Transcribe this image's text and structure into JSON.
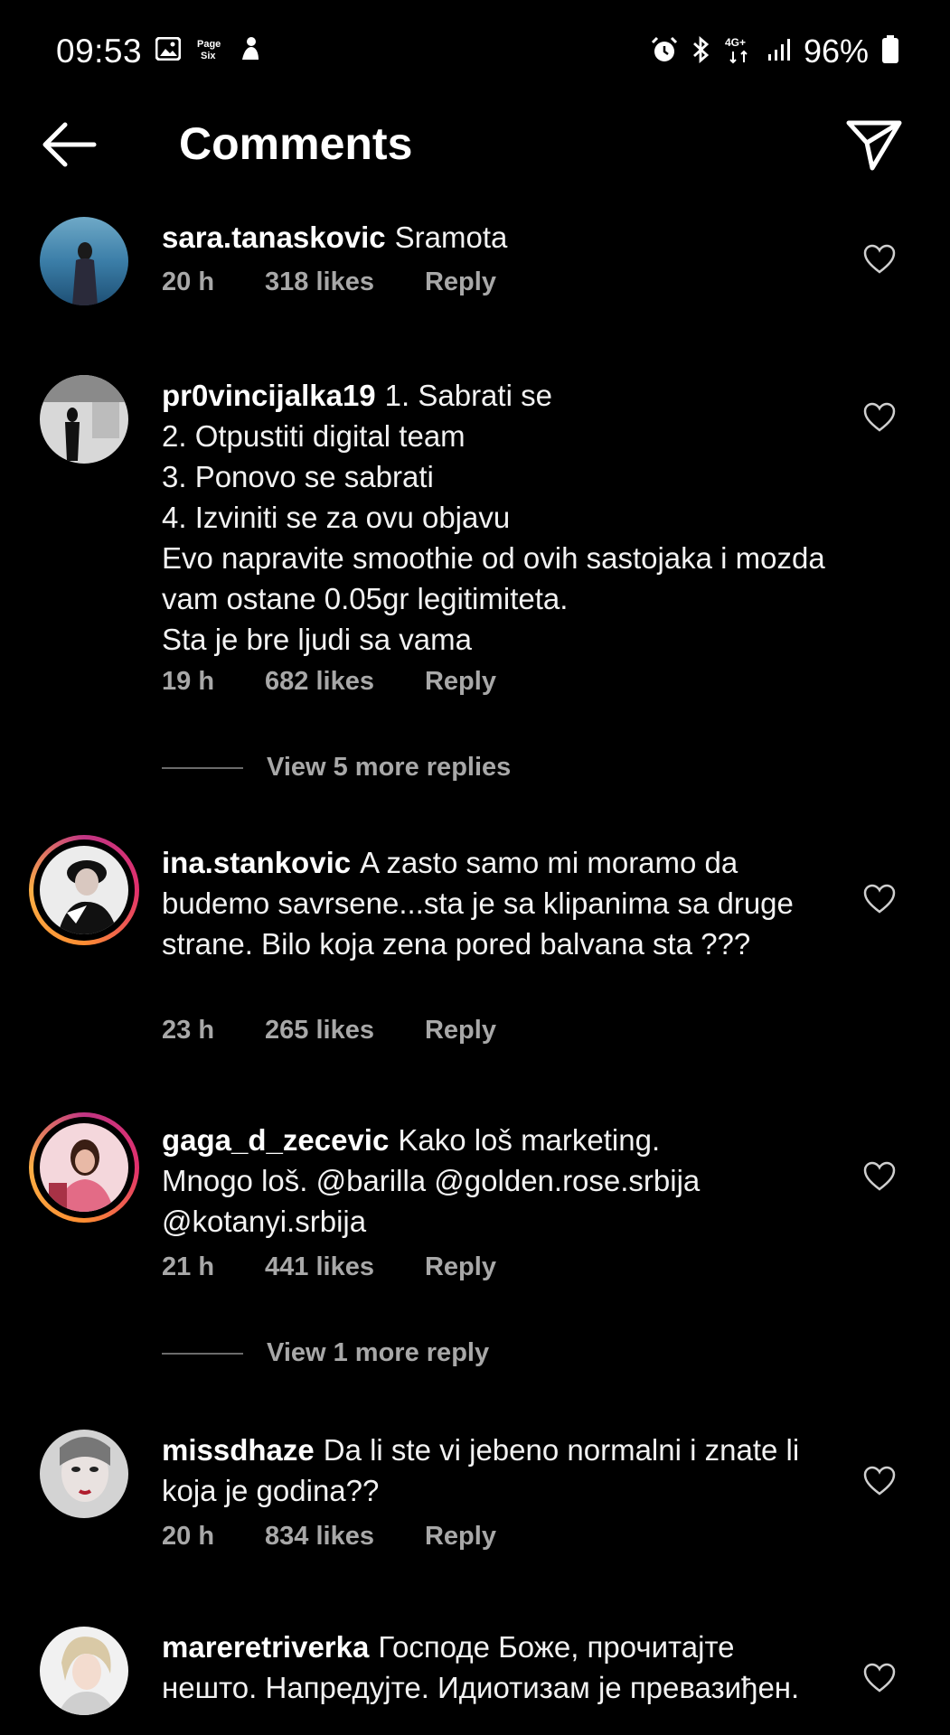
{
  "status_bar": {
    "time": "09:53",
    "battery": "96%",
    "network": "4G+",
    "left_icons": [
      "gallery-icon",
      "page-six-icon",
      "notification-icon"
    ],
    "right_icons": [
      "alarm-icon",
      "bluetooth-icon",
      "network-4g-icon",
      "signal-icon",
      "battery-icon"
    ]
  },
  "header": {
    "title": "Comments",
    "back_icon": "arrow-left-icon",
    "share_icon": "send-icon"
  },
  "comments": [
    {
      "username": "sara.tanaskovic",
      "text": "Sramota",
      "time": "20 h",
      "likes": "318 likes",
      "reply": "Reply",
      "story_ring": false
    },
    {
      "username": "pr0vincijalka19",
      "text": "1. Sabrati se\n2. Otpustiti digital team\n3. Ponovo se sabrati\n4. Izviniti se za ovu objavu\nEvo napravite smoothie od ovih sastojaka i mozda vam ostane 0.05gr legitimiteta.\nSta je bre ljudi sa vama",
      "time": "19 h",
      "likes": "682 likes",
      "reply": "Reply",
      "story_ring": false,
      "view_more": "View 5 more replies"
    },
    {
      "username": "ina.stankovic",
      "text": "A zasto samo mi moramo da budemo savrsene...sta je sa klipanima sa druge strane. Bilo koja  zena pored balvana sta ???",
      "time": "23 h",
      "likes": "265 likes",
      "reply": "Reply",
      "story_ring": true
    },
    {
      "username": "gaga_d_zecevic",
      "text": "Kako loš marketing.\nMnogo loš. @barilla @golden.rose.srbija\n@kotanyi.srbija",
      "time": "21 h",
      "likes": "441 likes",
      "reply": "Reply",
      "story_ring": true,
      "view_more": "View 1 more reply"
    },
    {
      "username": "missdhaze",
      "text": "Da li ste vi jebeno normalni i znate li koja je godina??",
      "time": "20 h",
      "likes": "834 likes",
      "reply": "Reply",
      "story_ring": false
    },
    {
      "username": "mareretriverka",
      "text": "Господе Боже, прочитајте нешто. Напредујте. Идиотизам је превазиђен.",
      "story_ring": false
    }
  ]
}
